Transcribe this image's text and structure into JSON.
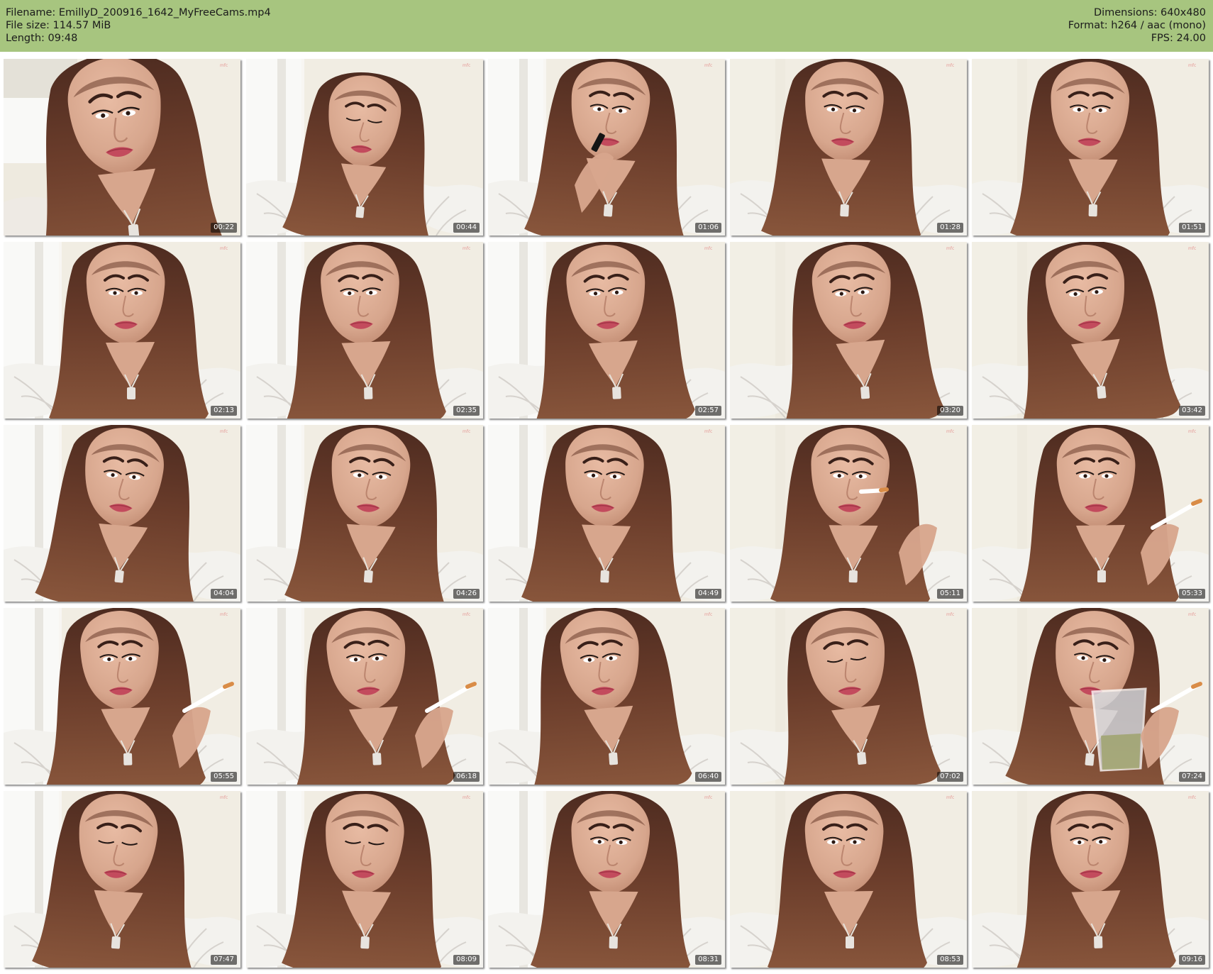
{
  "header": {
    "left": [
      "Filename: EmillyD_200916_1642_MyFreeCams.mp4",
      "File size: 114.57 MiB",
      "Length: 09:48"
    ],
    "right": [
      "Dimensions: 640x480",
      "Format: h264 / aac (mono)",
      "FPS: 24.00"
    ]
  },
  "thumbnails": [
    {
      "time": "00:22"
    },
    {
      "time": "00:44"
    },
    {
      "time": "01:06"
    },
    {
      "time": "01:28"
    },
    {
      "time": "01:51"
    },
    {
      "time": "02:13"
    },
    {
      "time": "02:35"
    },
    {
      "time": "02:57"
    },
    {
      "time": "03:20"
    },
    {
      "time": "03:42"
    },
    {
      "time": "04:04"
    },
    {
      "time": "04:26"
    },
    {
      "time": "04:49"
    },
    {
      "time": "05:11"
    },
    {
      "time": "05:33"
    },
    {
      "time": "05:55"
    },
    {
      "time": "06:18"
    },
    {
      "time": "06:40"
    },
    {
      "time": "07:02"
    },
    {
      "time": "07:24"
    },
    {
      "time": "07:47"
    },
    {
      "time": "08:09"
    },
    {
      "time": "08:31"
    },
    {
      "time": "08:53"
    },
    {
      "time": "09:16"
    }
  ],
  "colors": {
    "header_bg": "#a7c57f",
    "page_bg": "#ffffff",
    "hair": "#5a3324",
    "skin": "#d7a78f",
    "lace": "#f3f2ee"
  }
}
